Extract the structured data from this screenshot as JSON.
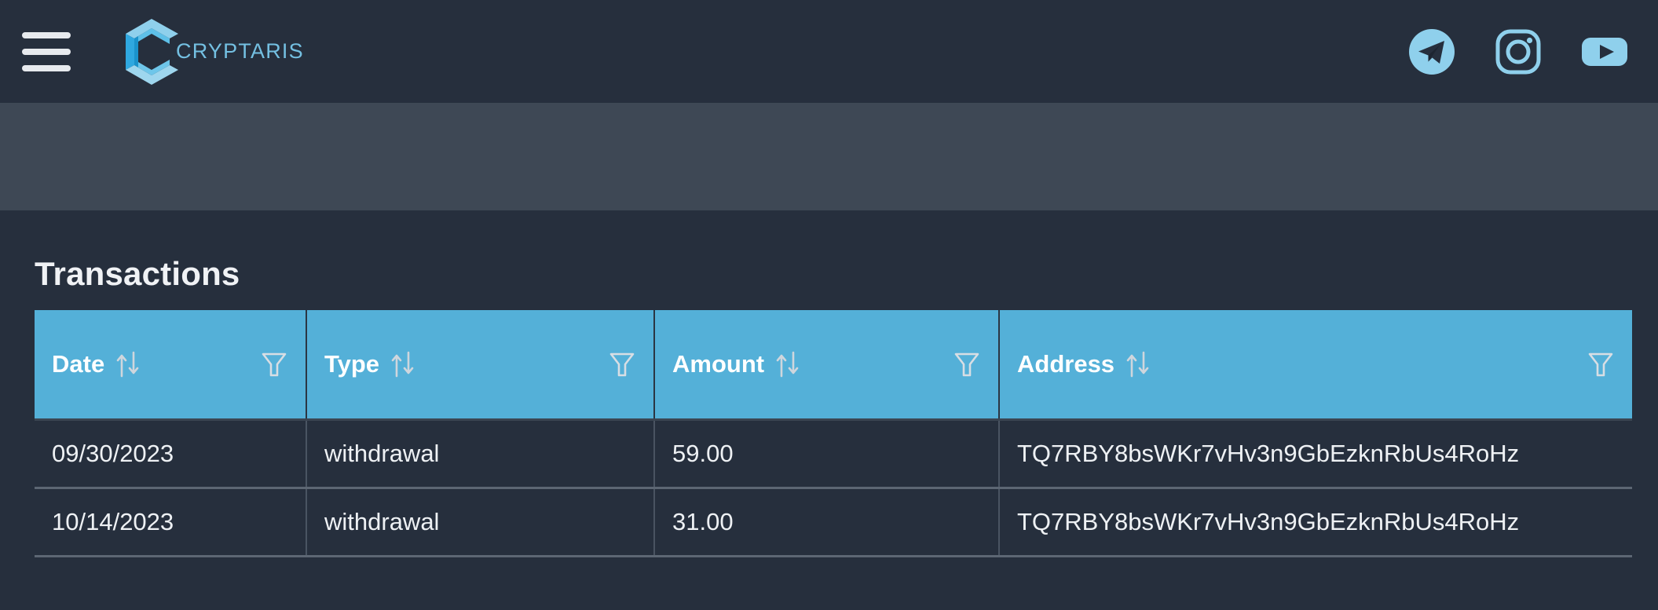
{
  "navbar": {
    "menu_icon": "hamburger-menu-icon",
    "brand_name": "CRYPTARIS",
    "logo_icon": "cryptaris-hexagon-c-logo",
    "accent_color": "#74c0e2",
    "background_color": "#262f3d",
    "social": [
      {
        "name": "telegram",
        "icon": "telegram-icon"
      },
      {
        "name": "instagram",
        "icon": "instagram-icon"
      },
      {
        "name": "youtube",
        "icon": "youtube-icon"
      }
    ]
  },
  "main": {
    "page_title": "Transactions",
    "table": {
      "header_color": "#54b0d8",
      "sort_icon": "sort-updown-icon",
      "filter_icon": "filter-funnel-icon",
      "columns": [
        {
          "label": "Date"
        },
        {
          "label": "Type"
        },
        {
          "label": "Amount"
        },
        {
          "label": "Address"
        }
      ],
      "rows": [
        {
          "date": "09/30/2023",
          "type": "withdrawal",
          "amount": "59.00",
          "address": "TQ7RBY8bsWKr7vHv3n9GbEzknRbUs4RoHz"
        },
        {
          "date": "10/14/2023",
          "type": "withdrawal",
          "amount": "31.00",
          "address": "TQ7RBY8bsWKr7vHv3n9GbEzknRbUs4RoHz"
        }
      ]
    }
  }
}
